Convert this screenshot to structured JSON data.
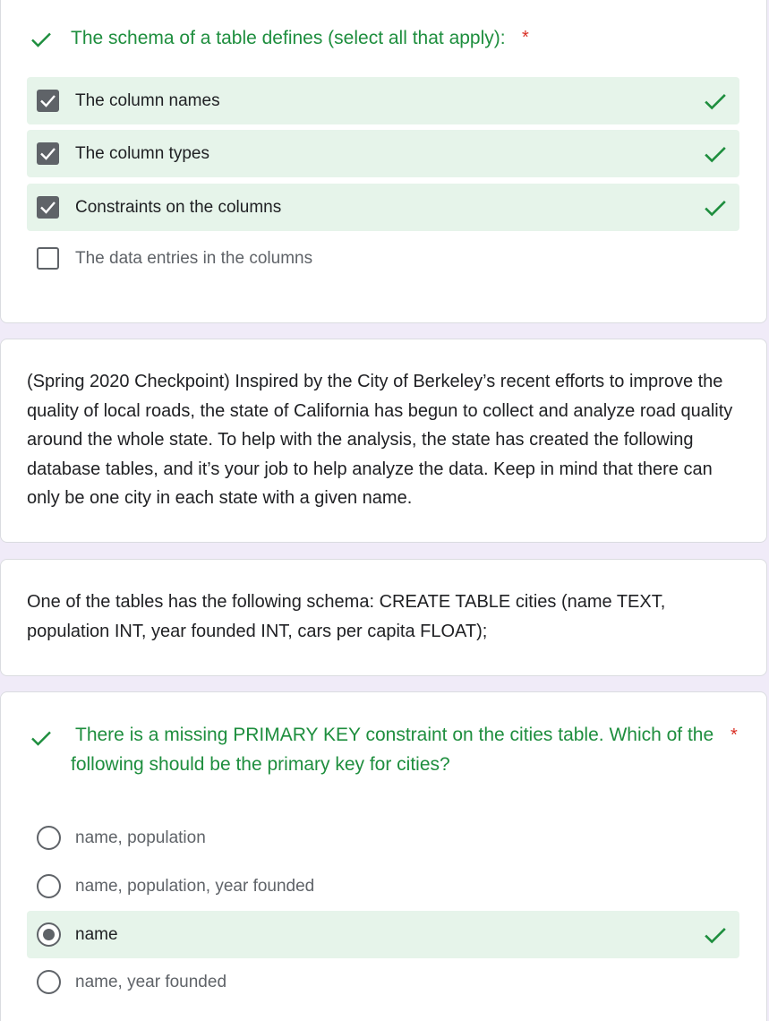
{
  "question1": {
    "title": "The schema of a table defines (select all that apply):",
    "required_mark": "*",
    "options": [
      {
        "label": "The column names",
        "checked": true,
        "correct": true
      },
      {
        "label": "The column types",
        "checked": true,
        "correct": true
      },
      {
        "label": "Constraints on the columns",
        "checked": true,
        "correct": true
      },
      {
        "label": "The data entries in the columns",
        "checked": false,
        "correct": false
      }
    ]
  },
  "section_description": {
    "text": "(Spring 2020 Checkpoint) Inspired by the City of Berkeley’s recent efforts to improve the quality of local roads, the state of California has begun to collect and analyze road quality around the whole state. To help with the analysis, the state has created the following database tables, and it’s your job to help analyze the data. Keep in mind that there can only be one city in each state with a given name."
  },
  "schema_description": {
    "text": "One of the tables has the following schema: CREATE TABLE cities (name TEXT, population INT, year founded INT, cars per capita FLOAT);"
  },
  "question2": {
    "title": "There is a missing PRIMARY KEY constraint on the cities table. Which of the following should be the primary key for cities?",
    "required_mark": "*",
    "options": [
      {
        "label": "name, population",
        "selected": false,
        "correct": false
      },
      {
        "label": "name, population, year founded",
        "selected": false,
        "correct": false
      },
      {
        "label": "name",
        "selected": true,
        "correct": true
      },
      {
        "label": "name, year founded",
        "selected": false,
        "correct": false
      }
    ]
  },
  "colors": {
    "correct_green": "#1e8e3e",
    "correct_bg": "#e6f4ea",
    "required_red": "#d93025",
    "page_bg": "#f0ebf8"
  },
  "icons": {
    "correct": "check-icon",
    "checkbox_checked": "checkbox-checked-icon",
    "checkbox_unchecked": "checkbox-unchecked-icon",
    "radio_selected": "radio-selected-icon",
    "radio_unselected": "radio-unselected-icon"
  }
}
